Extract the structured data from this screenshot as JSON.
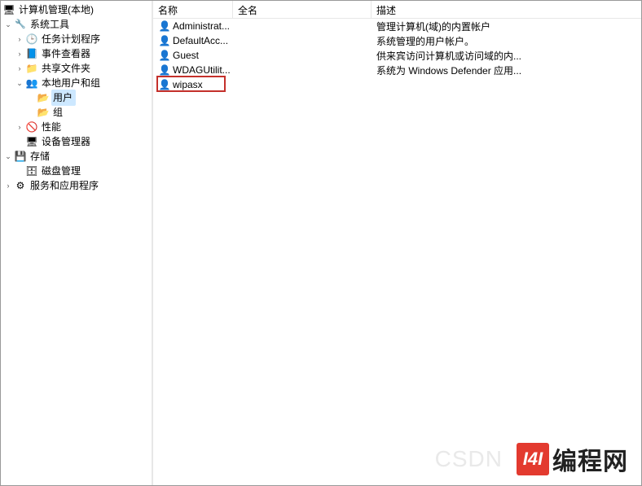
{
  "tree": {
    "root": "计算机管理(本地)",
    "system_tools": "系统工具",
    "task_scheduler": "任务计划程序",
    "event_viewer": "事件查看器",
    "shared_folders": "共享文件夹",
    "local_users_groups": "本地用户和组",
    "users": "用户",
    "groups": "组",
    "performance": "性能",
    "device_manager": "设备管理器",
    "storage": "存储",
    "disk_mgmt": "磁盘管理",
    "services_apps": "服务和应用程序"
  },
  "columns": {
    "name": "名称",
    "fullname": "全名",
    "desc": "描述"
  },
  "users": [
    {
      "name": "Administrat...",
      "fullname": "",
      "desc": "管理计算机(域)的内置帐户"
    },
    {
      "name": "DefaultAcc...",
      "fullname": "",
      "desc": "系统管理的用户帐户。"
    },
    {
      "name": "Guest",
      "fullname": "",
      "desc": "供来宾访问计算机或访问域的内..."
    },
    {
      "name": "WDAGUtilit...",
      "fullname": "",
      "desc": "系统为 Windows Defender 应用..."
    },
    {
      "name": "wipasx",
      "fullname": "",
      "desc": ""
    }
  ],
  "watermark": {
    "faded": "CSDN",
    "brand": "编程网",
    "logo": "I4I"
  }
}
